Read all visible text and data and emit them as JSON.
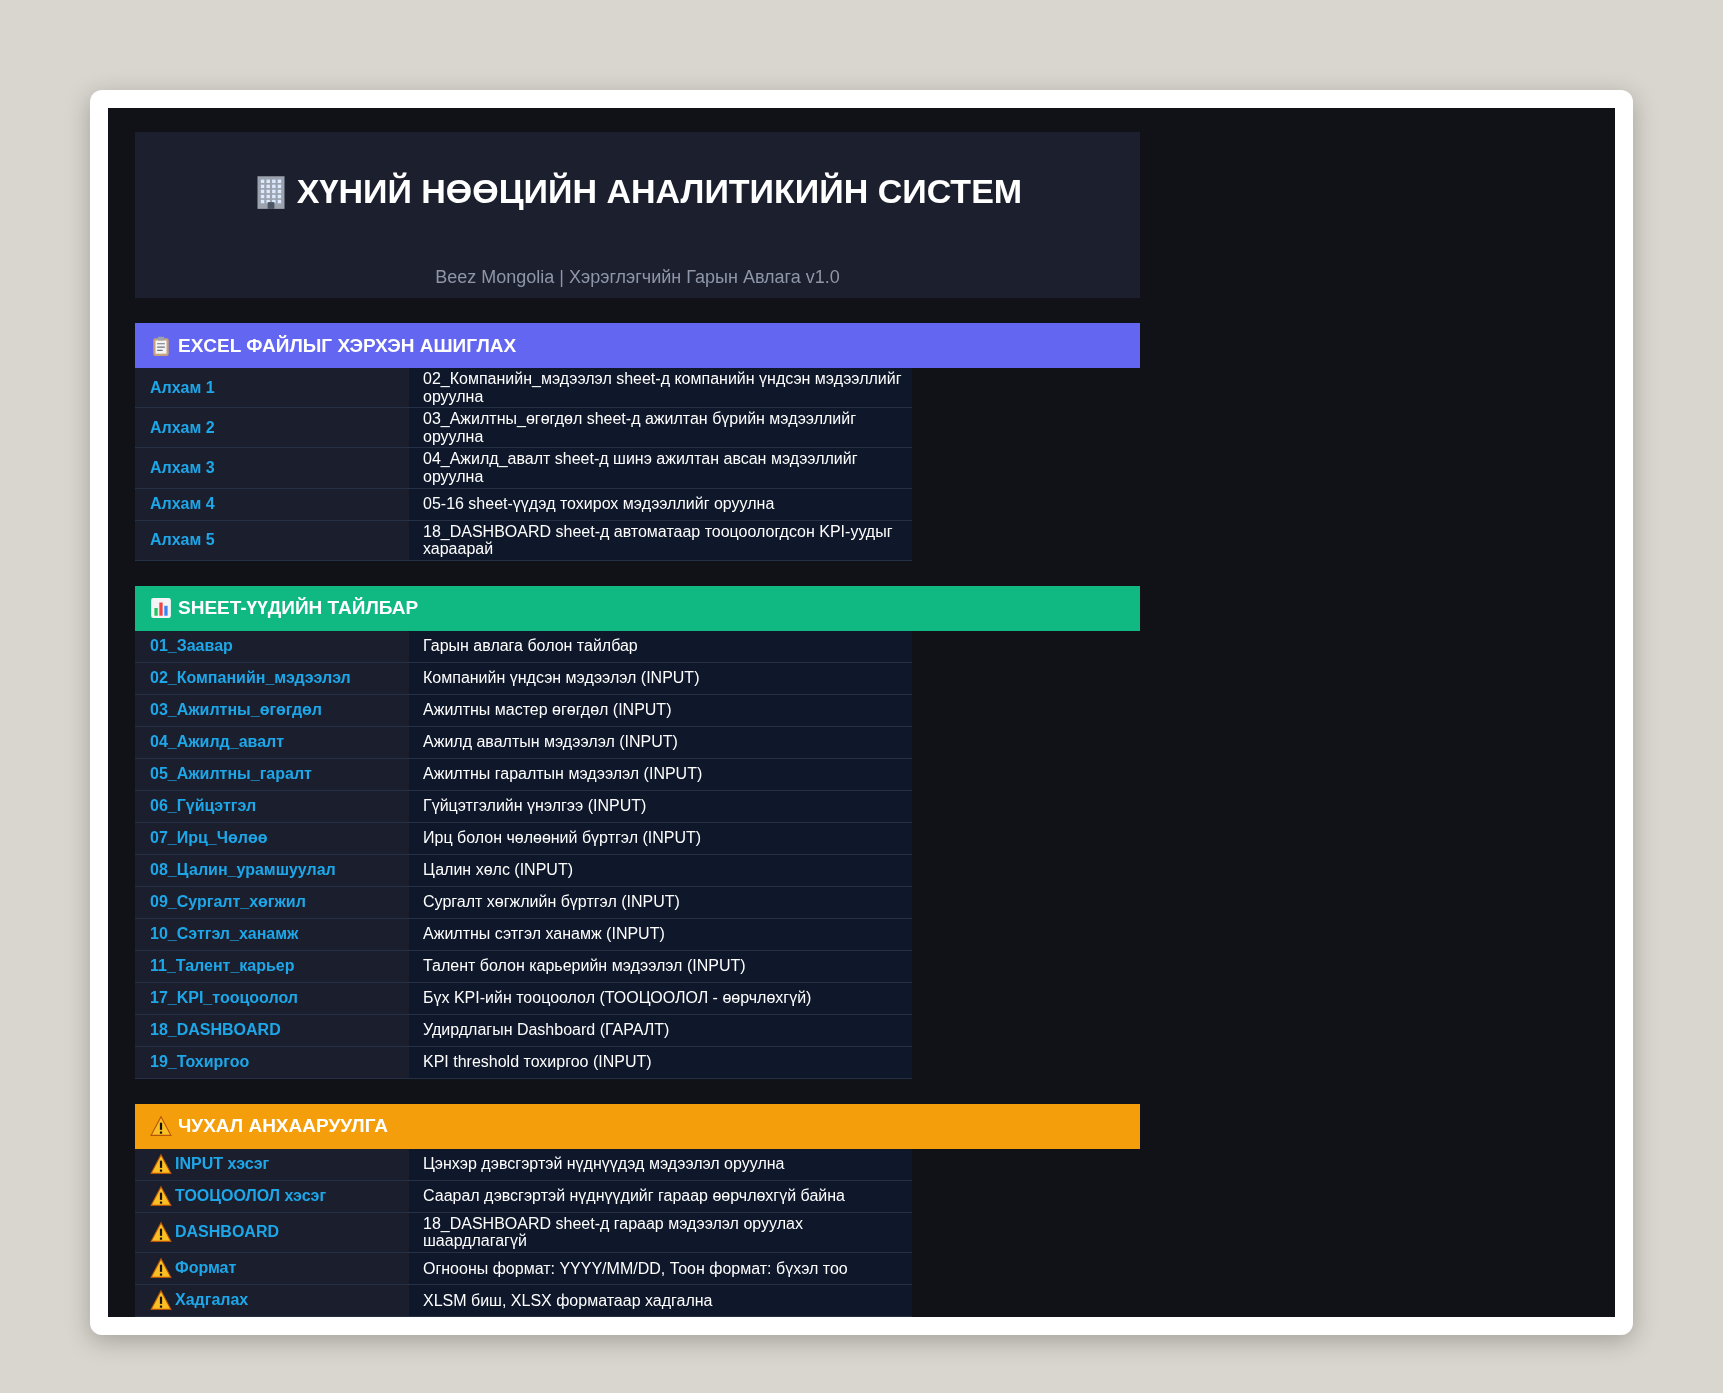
{
  "header": {
    "title": "ХҮНИЙ НӨӨЦИЙН АНАЛИТИКИЙН СИСТЕМ",
    "subtitle": "Beez Mongolia | Хэрэглэгчийн Гарын Авлага v1.0"
  },
  "sections": [
    {
      "title": "EXCEL ФАЙЛЫГ ХЭРХЭН АШИГЛАХ",
      "kind": "steps",
      "color": "#6366f1",
      "rows": [
        {
          "label": "Алхам 1",
          "text": "02_Компанийн_мэдээлэл sheet-д компанийн үндсэн мэдээллийг оруулна"
        },
        {
          "label": "Алхам 2",
          "text": "03_Ажилтны_өгөгдөл sheet-д ажилтан бүрийн мэдээллийг оруулна"
        },
        {
          "label": "Алхам 3",
          "text": "04_Ажилд_авалт sheet-д шинэ ажилтан авсан мэдээллийг оруулна"
        },
        {
          "label": "Алхам 4",
          "text": "05-16 sheet-үүдэд тохирох мэдээллийг оруулна"
        },
        {
          "label": "Алхам 5",
          "text": "18_DASHBOARD sheet-д автоматаар тооцоологдсон KPI-уудыг хараарай"
        }
      ]
    },
    {
      "title": "SHEET-ҮҮДИЙН ТАЙЛБАР",
      "kind": "sheets",
      "color": "#10b981",
      "rows": [
        {
          "label": "01_Заавар",
          "text": "Гарын авлага болон тайлбар"
        },
        {
          "label": "02_Компанийн_мэдээлэл",
          "text": "Компанийн үндсэн мэдээлэл (INPUT)"
        },
        {
          "label": "03_Ажилтны_өгөгдөл",
          "text": "Ажилтны мастер өгөгдөл (INPUT)"
        },
        {
          "label": "04_Ажилд_авалт",
          "text": "Ажилд авалтын мэдээлэл (INPUT)"
        },
        {
          "label": "05_Ажилтны_гаралт",
          "text": "Ажилтны гаралтын мэдээлэл (INPUT)"
        },
        {
          "label": "06_Гүйцэтгэл",
          "text": "Гүйцэтгэлийн үнэлгээ (INPUT)"
        },
        {
          "label": "07_Ирц_Чөлөө",
          "text": "Ирц болон чөлөөний бүртгэл (INPUT)"
        },
        {
          "label": "08_Цалин_урамшуулал",
          "text": "Цалин хөлс (INPUT)"
        },
        {
          "label": "09_Сургалт_хөгжил",
          "text": "Сургалт хөгжлийн бүртгэл (INPUT)"
        },
        {
          "label": "10_Сэтгэл_ханамж",
          "text": "Ажилтны сэтгэл ханамж (INPUT)"
        },
        {
          "label": "11_Талент_карьер",
          "text": "Талент болон карьерийн мэдээлэл (INPUT)"
        },
        {
          "label": "17_KPI_тооцоолол",
          "text": "Бүх KPI-ийн тооцоолол (ТООЦООЛОЛ - өөрчлөхгүй)"
        },
        {
          "label": "18_DASHBOARD",
          "text": "Удирдлагын Dashboard (ГАРАЛТ)"
        },
        {
          "label": "19_Тохиргоо",
          "text": "KPI threshold тохиргоо (INPUT)"
        }
      ]
    },
    {
      "title": "ЧУХАЛ АНХААРУУЛГА",
      "kind": "warnings",
      "color": "#f59e0b",
      "rows": [
        {
          "label": "INPUT хэсэг",
          "text": "Цэнхэр дэвсгэртэй нүднүүдэд мэдээлэл оруулна"
        },
        {
          "label": "ТООЦООЛОЛ хэсэг",
          "text": "Саарал дэвсгэртэй нүднүүдийг гараар өөрчлөхгүй байна"
        },
        {
          "label": "DASHBOARD",
          "text": "18_DASHBOARD sheet-д гараар мэдээлэл оруулах шаардлагагүй"
        },
        {
          "label": "Формат",
          "text": "Огнооны формат: YYYY/MM/DD, Тоон формат: бүхэл тоо"
        },
        {
          "label": "Хадгалах",
          "text": "XLSM биш, XLSX форматаар хадгална"
        }
      ]
    }
  ]
}
